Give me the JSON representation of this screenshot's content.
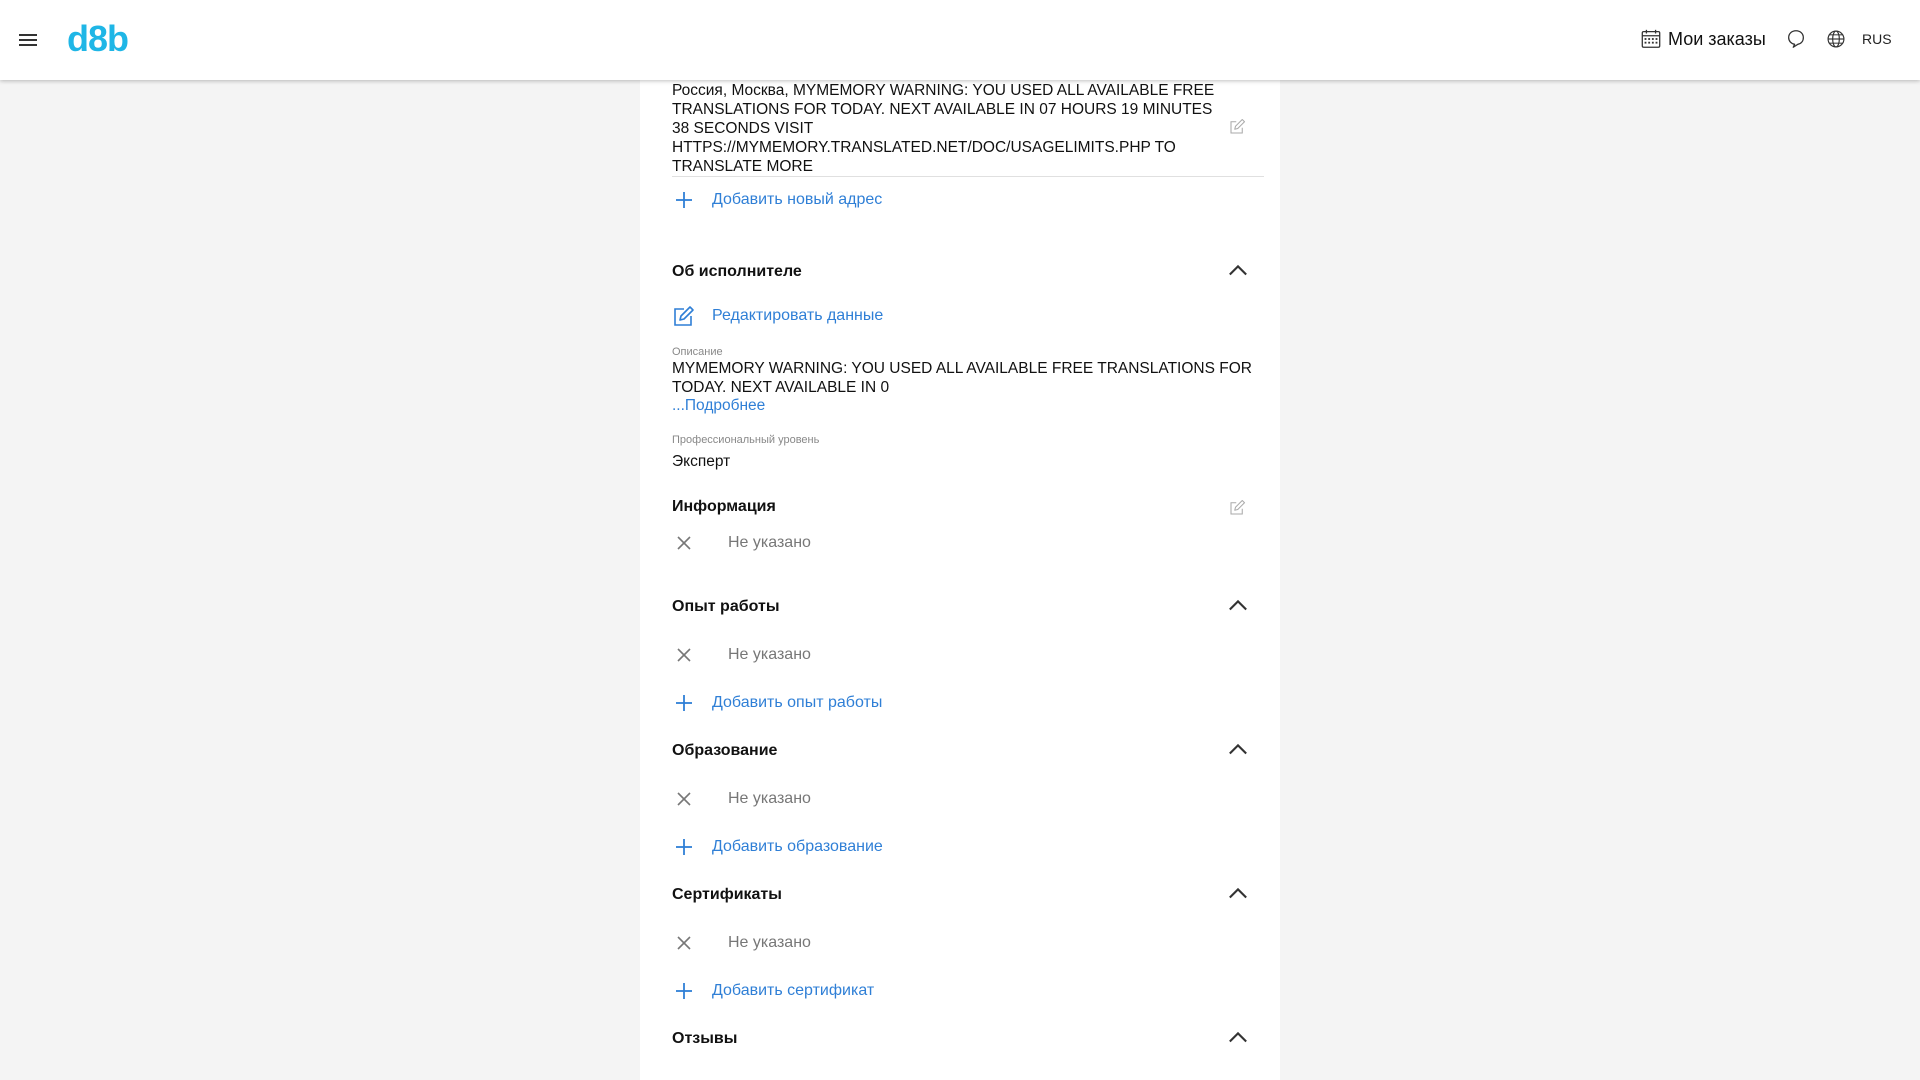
{
  "header": {
    "logo_text": "d8b",
    "orders_label": "Мои заказы",
    "language": "RUS"
  },
  "address": {
    "text": "Россия, Москва, MYMEMORY WARNING: YOU USED ALL AVAILABLE FREE TRANSLATIONS FOR TODAY. NEXT AVAILABLE IN 07 HOURS 19 MINUTES 38 SECONDS VISIT HTTPS://MYMEMORY.TRANSLATED.NET/DOC/USAGELIMITS.PHP TO TRANSLATE MORE",
    "add_label": "Добавить новый адрес"
  },
  "about": {
    "title": "Об исполнителе",
    "edit_label": "Редактировать данные",
    "description_label": "Описание",
    "description_text": "MYMEMORY WARNING: YOU USED ALL AVAILABLE FREE TRANSLATIONS FOR TODAY. NEXT AVAILABLE IN  0",
    "more_label": "...Подробнее",
    "level_label": "Профессиональный уровень",
    "level_value": "Эксперт"
  },
  "info": {
    "title": "Информация",
    "empty_text": "Не указано"
  },
  "experience": {
    "title": "Опыт работы",
    "empty_text": "Не указано",
    "add_label": "Добавить опыт работы"
  },
  "education": {
    "title": "Образование",
    "empty_text": "Не указано",
    "add_label": "Добавить образование"
  },
  "certificates": {
    "title": "Сертификаты",
    "empty_text": "Не указано",
    "add_label": "Добавить сертификат"
  },
  "reviews": {
    "title": "Отзывы"
  },
  "icons": {
    "menu": "menu-icon",
    "orders": "calendar-icon",
    "chat": "chat-icon",
    "language": "globe-icon",
    "edit": "edit-icon",
    "add": "plus-icon",
    "empty": "close-icon",
    "collapse": "chevron-up-icon"
  },
  "colors": {
    "brand": "#1fb6e6",
    "link": "#2f7fd6",
    "background": "#f4f4f4"
  }
}
